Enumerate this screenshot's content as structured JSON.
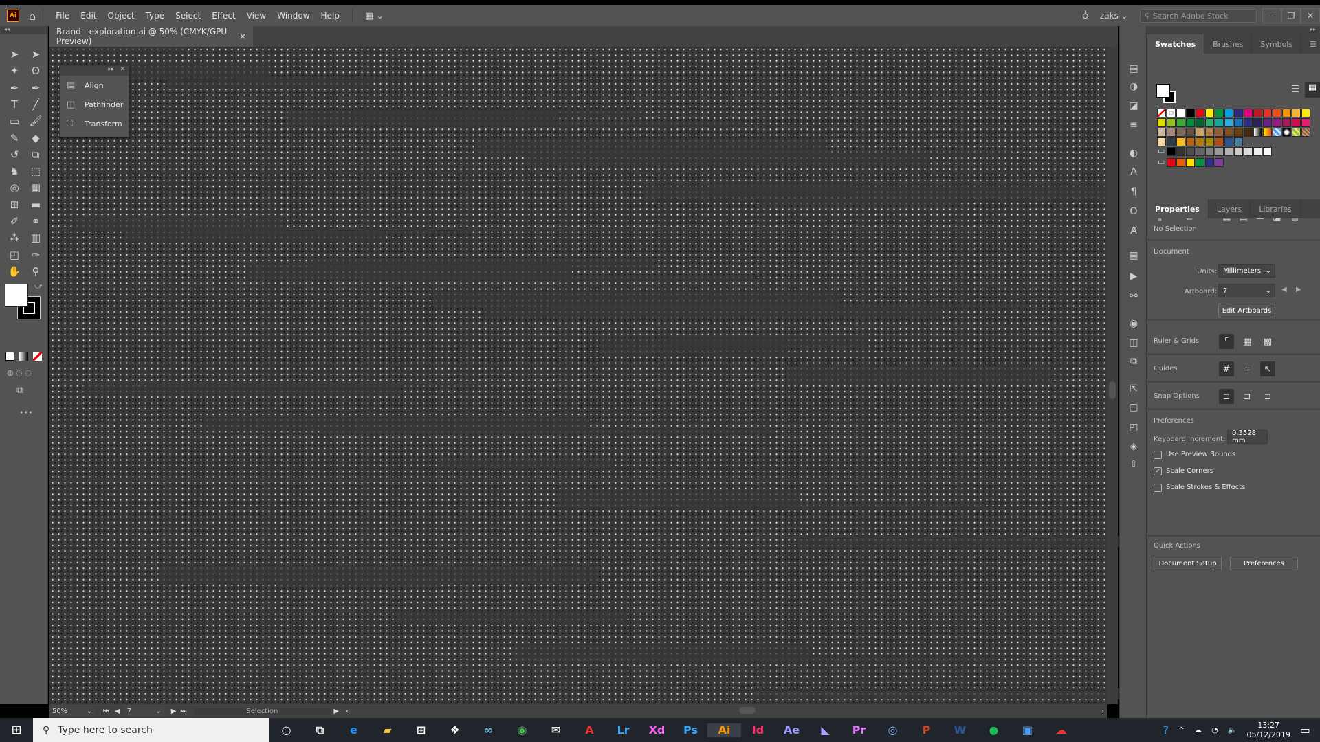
{
  "app": {
    "logo": "Ai",
    "home_icon": "home-icon",
    "menu": [
      "File",
      "Edit",
      "Object",
      "Type",
      "Select",
      "Effect",
      "View",
      "Window",
      "Help"
    ],
    "user": "zaks",
    "search_placeholder": "Search Adobe Stock"
  },
  "document": {
    "tab_title": "Brand - exploration.ai @ 50% (CMYK/GPU Preview)",
    "close": "×"
  },
  "tools": [
    "selection",
    "direct-selection",
    "magic-wand",
    "lasso",
    "pen",
    "curvature",
    "type",
    "line",
    "rectangle",
    "paintbrush",
    "shaper",
    "eraser",
    "rotate",
    "scale",
    "puppet-warp",
    "free-transform",
    "shape-builder",
    "perspective-grid",
    "mesh",
    "gradient",
    "eyedropper",
    "blend",
    "symbol-sprayer",
    "column-graph",
    "artboard",
    "slice",
    "hand",
    "zoom"
  ],
  "float_panel": {
    "items": [
      "Align",
      "Pathfinder",
      "Transform"
    ]
  },
  "swatches_panel": {
    "tabs": [
      "Swatches",
      "Brushes",
      "Symbols"
    ],
    "rows": [
      [
        "none",
        "registration",
        "#ffffff",
        "#000000",
        "#e30613",
        "#ffed00",
        "#009640",
        "#009fe3",
        "#312783",
        "#e6007e",
        "#be1622",
        "#e6332a",
        "#e94e1b",
        "#f39200",
        "#f9b233",
        "#ffed00"
      ],
      [
        "#dedc00",
        "#95c11f",
        "#3aaa35",
        "#008d36",
        "#006633",
        "#2fac66",
        "#13a89e",
        "#36a9e1",
        "#1d71b8",
        "#2d2e83",
        "#29235c",
        "#662483",
        "#951b81",
        "#a3195b",
        "#d60b52",
        "#e71d73"
      ],
      [
        "#cbbba0",
        "#a48a7b",
        "#7b6a58",
        "#634e42",
        "#cba16a",
        "#b17f4a",
        "#936037",
        "#7e4e24",
        "#683c11",
        "#432918",
        "gradient-gray",
        "gradient-orange",
        "pattern-blue",
        "radial-gray",
        "pattern-green",
        "pattern-brown"
      ],
      [
        "#f5d6a8",
        "#2f3c47",
        "#fbba16",
        "#b7650f",
        "#b57a0a",
        "#a88a00",
        "#b44e18",
        "#2b5592",
        "#4a7ea3"
      ]
    ],
    "group1": [
      "#000000",
      "#333333",
      "#4d4d4d",
      "#666666",
      "#808080",
      "#999999",
      "#b3b3b3",
      "#cccccc",
      "#dddddd",
      "#eeeeee",
      "#f6f6f6"
    ],
    "group2": [
      "#e30613",
      "#eb5b0c",
      "#ffde00",
      "#009640",
      "#2d2e83",
      "#7f3f98"
    ]
  },
  "properties_panel": {
    "tabs": [
      "Properties",
      "Layers",
      "Libraries"
    ],
    "no_selection": "No Selection",
    "document": "Document",
    "units_label": "Units:",
    "units_value": "Millimeters",
    "artboard_label": "Artboard:",
    "artboard_value": "7",
    "edit_artboards": "Edit Artboards",
    "ruler_grids": "Ruler & Grids",
    "guides": "Guides",
    "snap_options": "Snap Options",
    "preferences_heading": "Preferences",
    "keyboard_increment_label": "Keyboard Increment:",
    "keyboard_increment_value": "0.3528 mm",
    "checkboxes": [
      {
        "label": "Use Preview Bounds",
        "checked": false
      },
      {
        "label": "Scale Corners",
        "checked": true
      },
      {
        "label": "Scale Strokes & Effects",
        "checked": false
      }
    ],
    "quick_actions": "Quick Actions",
    "document_setup": "Document Setup",
    "preferences_button": "Preferences"
  },
  "status": {
    "zoom": "50%",
    "artboard": "7",
    "tool": "Selection"
  },
  "taskbar": {
    "search_placeholder": "Type here to search",
    "apps": [
      "cortana",
      "task-view",
      "edge",
      "file-explorer",
      "store",
      "dropbox",
      "infinity",
      "chrome",
      "mail",
      "acrobat",
      "lightroom",
      "xd",
      "photoshop",
      "illustrator",
      "indesign",
      "after-effects",
      "premiere-rush",
      "premiere",
      "browser",
      "powerpoint",
      "word",
      "spotify",
      "app",
      "creative-cloud"
    ],
    "time": "13:27",
    "date": "05/12/2019"
  }
}
